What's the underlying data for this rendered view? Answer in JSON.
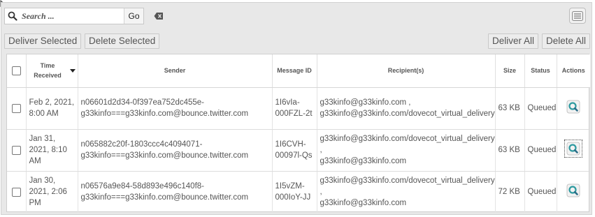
{
  "toolbar": {
    "search_placeholder": "Search ...",
    "go_label": "Go",
    "deliver_selected": "Deliver Selected",
    "delete_selected": "Delete Selected",
    "deliver_all": "Deliver All",
    "delete_all": "Delete All"
  },
  "table": {
    "columns": {
      "time_received": "Time Received",
      "sender": "Sender",
      "message_id": "Message ID",
      "recipients": "Recipient(s)",
      "size": "Size",
      "status": "Status",
      "actions": "Actions"
    },
    "rows": [
      {
        "time": "Feb 2, 2021, 8:00 AM",
        "sender_line1": "n06601d2d34-0f397ea752dc455e-",
        "sender_line2": "g33kinfo===g33kinfo.com@bounce.twitter.com",
        "msgid_line1": "1I6vIa-",
        "msgid_line2": "000FZL-2t",
        "recip_line1": "g33kinfo@g33kinfo.com ,",
        "recip_line2": "g33kinfo@g33kinfo.com/dovecot_virtual_delivery",
        "recip_line3": "",
        "size": "63 KB",
        "status": "Queued"
      },
      {
        "time": "Jan 31, 2021, 8:10 AM",
        "sender_line1": "n065882c20f-1803ccc4c4094071-",
        "sender_line2": "g33kinfo===g33kinfo.com@bounce.twitter.com",
        "msgid_line1": "1I6CVH-",
        "msgid_line2": "00097l-Qs",
        "recip_line1": "g33kinfo@g33kinfo.com/dovecot_virtual_delivery",
        "recip_line2": ",",
        "recip_line3": "g33kinfo@g33kinfo.com",
        "size": "63 KB",
        "status": "Queued"
      },
      {
        "time": "Jan 30, 2021, 2:06 PM",
        "sender_line1": "n06576a9e84-58d893e496c140f8-",
        "sender_line2": "g33kinfo===g33kinfo.com@bounce.twitter.com",
        "msgid_line1": "1I5vZM-",
        "msgid_line2": "000IoY-JJ",
        "recip_line1": "g33kinfo@g33kinfo.com/dovecot_virtual_delivery",
        "recip_line2": ",",
        "recip_line3": "g33kinfo@g33kinfo.com",
        "size": "72 KB",
        "status": "Queued"
      }
    ]
  },
  "icons": {
    "search": "search-icon",
    "clear": "backspace-icon",
    "menu": "list-menu-icon",
    "view": "magnifier-view-icon"
  },
  "colors": {
    "panel_bg": "#e8e8e8",
    "button_bg": "#ececec",
    "icon_teal": "#2e9aa0"
  }
}
